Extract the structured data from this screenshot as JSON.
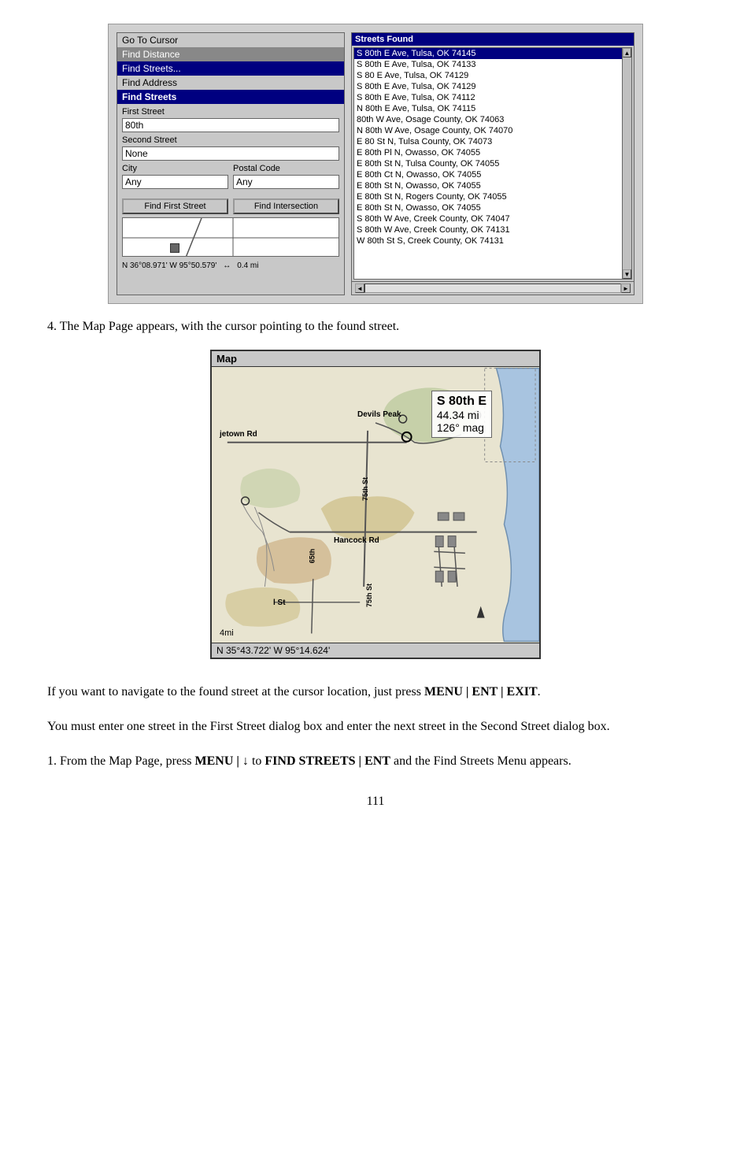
{
  "screenshot": {
    "leftPanel": {
      "menuItems": [
        {
          "label": "Go To Cursor",
          "state": "normal"
        },
        {
          "label": "Find Distance",
          "state": "normal"
        },
        {
          "label": "Find Streets...",
          "state": "highlighted"
        },
        {
          "label": "Find Address",
          "state": "normal"
        }
      ],
      "findStreetsHeader": "Find Streets",
      "firstStreetLabel": "First Street",
      "firstStreetValue": "80th",
      "secondStreetLabel": "Second Street",
      "secondStreetValue": "None",
      "cityLabel": "City",
      "cityValue": "Any",
      "postalCodeLabel": "Postal Code",
      "postalCodeValue": "Any",
      "findFirstStreetBtn": "Find First Street",
      "findIntersectionBtn": "Find Intersection",
      "coords": "N  36°08.971'  W  95°50.579'",
      "scale": "0.4 mi"
    },
    "rightPanel": {
      "header": "Streets Found",
      "streets": [
        {
          "label": "S 80th E Ave, Tulsa, OK 74145",
          "selected": true
        },
        {
          "label": "S 80th E Ave, Tulsa, OK 74133",
          "selected": false
        },
        {
          "label": "S 80 E Ave, Tulsa, OK 74129",
          "selected": false
        },
        {
          "label": "S 80th E Ave, Tulsa, OK 74129",
          "selected": false
        },
        {
          "label": "S 80th E Ave, Tulsa, OK 74112",
          "selected": false
        },
        {
          "label": "N 80th E Ave, Tulsa, OK 74115",
          "selected": false
        },
        {
          "label": "80th W Ave, Osage County, OK 74063",
          "selected": false
        },
        {
          "label": "N 80th W Ave, Osage County, OK 74070",
          "selected": false
        },
        {
          "label": "E 80 St N, Tulsa County, OK 74073",
          "selected": false
        },
        {
          "label": "E 80th Pl N, Owasso, OK 74055",
          "selected": false
        },
        {
          "label": "E 80th St N, Tulsa County, OK 74055",
          "selected": false
        },
        {
          "label": "E 80th Ct N, Owasso, OK 74055",
          "selected": false
        },
        {
          "label": "E 80th St N, Owasso, OK 74055",
          "selected": false
        },
        {
          "label": "E 80th St N, Rogers County, OK 74055",
          "selected": false
        },
        {
          "label": "E 80th St N, Owasso, OK 74055",
          "selected": false
        },
        {
          "label": "S 80th W Ave, Creek County, OK 74047",
          "selected": false
        },
        {
          "label": "S 80th W Ave, Creek County, OK 74131",
          "selected": false
        },
        {
          "label": "W 80th St S, Creek County, OK 74131",
          "selected": false
        }
      ]
    }
  },
  "step4Text": "4. The Map Page appears, with the cursor pointing to the found street.",
  "map": {
    "title": "Map",
    "infoLine1": "S 80th E",
    "infoLine2": "44.34 mi",
    "infoLine3": "126° mag",
    "label_jetown": "jetown Rd",
    "label_devils": "Devils Peak",
    "label_75th": "75th St",
    "label_hancock": "Hancock Rd",
    "label_65th": "65th",
    "label_75th2": "75th St",
    "label_lst": "l St",
    "scale": "4mi",
    "coords": "N  35°43.722'  W  95°14.624'"
  },
  "body": {
    "para1": "If you want to navigate to the found street at the cursor location, just press ",
    "para1bold": "MENU | ENT | EXIT",
    "para1end": ".",
    "para2": "You must enter one street in the First Street dialog box and enter the next street in the Second Street dialog box.",
    "para3start": "1. From the Map Page, press ",
    "para3bold1": "MENU | ↓",
    "para3mid": " to ",
    "para3bold2": "FIND STREETS | ENT",
    "para3end": " and the Find Streets Menu appears.",
    "pageNumber": "111"
  }
}
